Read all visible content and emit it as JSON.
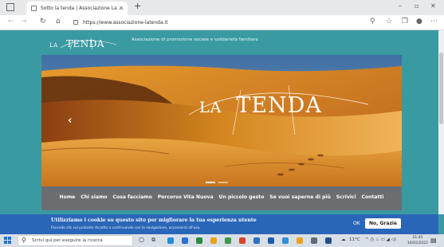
{
  "browser": {
    "tab_title": "Sotto la tenda | Associazione La ...",
    "tab_close": "×",
    "new_tab": "+",
    "url": "https://www.associazione-latenda.it",
    "window_controls": [
      "–",
      "▫",
      "✕"
    ]
  },
  "site": {
    "logo_small": "LA",
    "logo_big": "TENDA",
    "tagline": "Associazione di promozione sociale e solidarietà familiare",
    "hero": {
      "title_small": "LA",
      "title_big": "TENDA",
      "prev_arrow": "‹",
      "sky_top": "#3f6ea3",
      "sand_color": "#d4861f"
    },
    "menu": [
      "Home",
      "Chi siamo",
      "Cosa facciamo",
      "Percorso Vita Nuova",
      "Un piccolo gesto",
      "Se vuoi saperne di più",
      "Scrivici",
      "Contatti"
    ]
  },
  "cookie_banner": {
    "title": "Utilizziamo i cookie su questo sito per migliorare la tua esperienza utente",
    "description": "Facendo clic sul pulsante Accetta o continuando con la navigazione, acconsenti all'uso.",
    "ok_label": "OK",
    "decline_label": "No, Grazie"
  },
  "taskbar": {
    "search_placeholder": "Scrivi qui per eseguire la ricerca",
    "tray_temp": "11°C",
    "time": "21:45",
    "date": "16/02/2022"
  },
  "colors": {
    "page_bg": "#3a9aa2",
    "menu_bg": "#6a6e71",
    "cookie_bg": "#2a66b8"
  }
}
